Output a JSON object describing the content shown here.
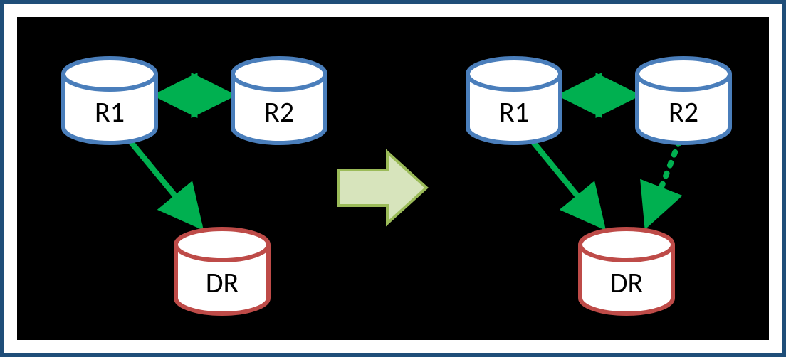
{
  "diagram": {
    "left": {
      "r1": "R1",
      "r2": "R2",
      "dr": "DR"
    },
    "right": {
      "r1": "R1",
      "r2": "R2",
      "dr": "DR"
    }
  },
  "colors": {
    "border": "#1f4e79",
    "blueStroke": "#4a7ebb",
    "redStroke": "#be4b48",
    "green": "#00b050",
    "arrowFill": "#d7e4bc",
    "arrowStroke": "#9bbb59"
  }
}
